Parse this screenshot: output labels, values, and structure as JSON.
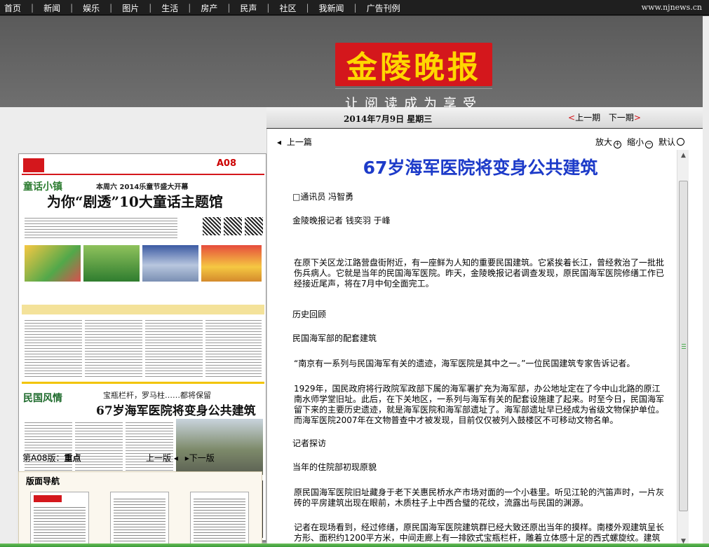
{
  "nav": {
    "items": [
      "首页",
      "新闻",
      "娱乐",
      "图片",
      "生活",
      "房产",
      "民声",
      "社区",
      "我新闻",
      "广告刊例"
    ],
    "site": "www.njnews.cn"
  },
  "header": {
    "logo_text": "金陵晚报",
    "slogan": "让阅读成为享受"
  },
  "datebar": {
    "date": "2014年7月9日  星期三",
    "prev_issue": "上一期",
    "next_issue": "下一期",
    "arrow_left": "<",
    "arrow_right": ">"
  },
  "paper": {
    "page_no": "A08",
    "column1": "童话小镇",
    "sub1": "本周六  2014乐童节盛大开幕",
    "headline1": "为你“剧透”10大童话主题馆",
    "column2": "民国风情",
    "sub2": "宝瓶栏杆，罗马柱……都将保留",
    "headline2": "67岁海军医院将变身公共建筑"
  },
  "page_info": {
    "label": "第A08版：",
    "value": "重点",
    "prev_page": "上一版",
    "next_page": "下一版"
  },
  "edition_nav": {
    "title": "版面导航"
  },
  "article": {
    "prev": "上一篇",
    "zoom_in": "放大",
    "zoom_out": "缩小",
    "default": "默认",
    "headline_num": "67",
    "headline_rest": "岁海军医院将变身公共建筑",
    "paragraphs": [
      "□通讯员  冯智勇",
      "金陵晚报记者  钱奕羽  于峰",
      "  在原下关区龙江路营盘街附近，有一座鲜为人知的重要民国建筑。它紧挨着长江，曾经救治了一批批伤兵病人。它就是当年的民国海军医院。昨天，金陵晚报记者调查发现，原民国海军医院修缮工作已经接近尾声，将在7月中旬全面完工。",
      "历史回顾",
      "民国海军部的配套建筑",
      "  “南京有一系列与民国海军有关的遗迹，海军医院是其中之一。”一位民国建筑专家告诉记者。",
      "  1929年，国民政府将行政院军政部下属的海军署扩充为海军部，办公地址定在了今中山北路的原江南水师学堂旧址。此后，在下关地区，一系列与海军有关的配套设施建了起来。时至今日，民国海军留下来的主要历史遗迹，就是海军医院和海军部遗址了。海军部遗址早已经成为省级文物保护单位。而海军医院2007年在文物普查中才被发现，目前仅仅被列入鼓楼区不可移动文物名单。",
      "记者探访",
      "当年的住院部初现原貌",
      "  原民国海军医院旧址藏身于老下关惠民桥水产市场对面的一个小巷里。听见江轮的汽笛声时，一片灰砖的平房建筑出现在眼前，木质柱子上中西合璧的花纹，流露出与民国的渊源。",
      "  记者在现场看到，经过修缮，原民国海军医院建筑群已经大致还原出当年的摸样。南楼外观建筑呈长方形、面积约1200平方米，中间走廊上有一排欧式宝瓶栏杆，雕着立体感十足的西式螺旋纹。建筑"
    ]
  }
}
